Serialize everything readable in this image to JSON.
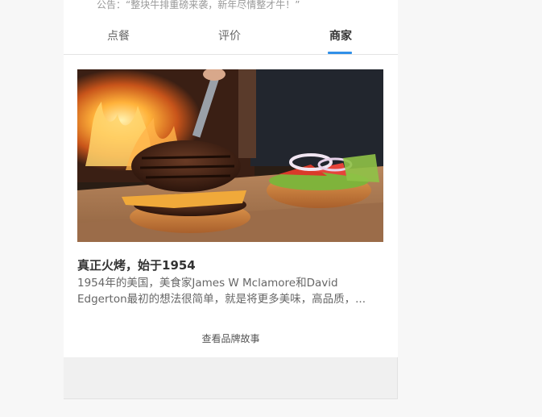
{
  "notice": {
    "text": "公告：“整块牛排重磅来袭，新年尽情整才牛！”"
  },
  "tabs": [
    {
      "label": "点餐"
    },
    {
      "label": "评价"
    },
    {
      "label": "商家"
    }
  ],
  "active_tab": "商家",
  "brand": {
    "title": "真正火烤，始于1954",
    "desc_line1": "1954年的美国，美食家James W Mclamore和David",
    "desc_line2": "Edgerton最初的想法很简单，就是将更多美味，高品质，...",
    "story_button": "查看品牌故事"
  },
  "colors": {
    "accent": "#3190e8"
  }
}
